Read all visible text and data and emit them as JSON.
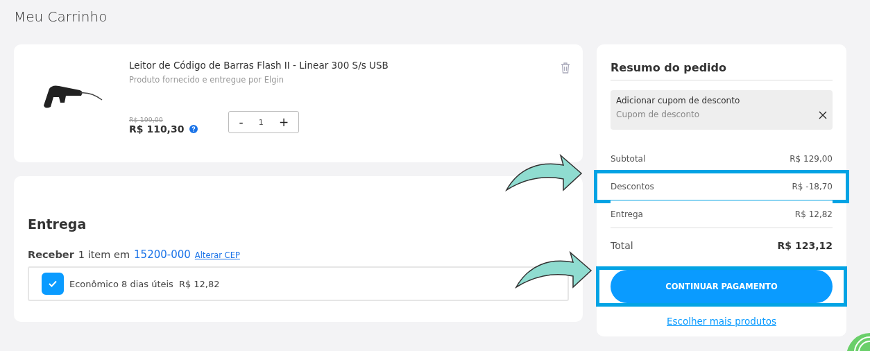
{
  "page_title": "Meu Carrinho",
  "cart_item": {
    "name": "Leitor de Código de Barras Flash II - Linear 300 S/s USB",
    "seller": "Produto fornecido e entregue por Elgin",
    "old_price": "R$ 199,00",
    "price": "R$ 110,30",
    "quantity": "1",
    "minus": "-",
    "plus": "+"
  },
  "delivery": {
    "title": "Entrega",
    "receive_label": "Receber",
    "items_text": "1 item em",
    "cep": "15200-000",
    "change_link": "Alterar CEP",
    "options": [
      {
        "label": "Econômico 8 dias úteis",
        "price": "R$ 12,82",
        "checked": true
      }
    ]
  },
  "summary": {
    "title": "Resumo do pedido",
    "coupon_label": "Adicionar cupom de desconto",
    "coupon_placeholder": "Cupom de desconto",
    "lines": [
      {
        "label": "Subtotal",
        "value": "R$ 129,00",
        "highlighted": false
      },
      {
        "label": "Descontos",
        "value": "R$ -18,70",
        "highlighted": true
      },
      {
        "label": "Entrega",
        "value": "R$ 12,82",
        "highlighted": false
      }
    ],
    "total_label": "Total",
    "total_value": "R$ 123,12",
    "continue_button": {
      "label": "CONTINUAR PAGAMENTO",
      "highlighted": true
    },
    "more_link": "Escolher mais produtos"
  }
}
